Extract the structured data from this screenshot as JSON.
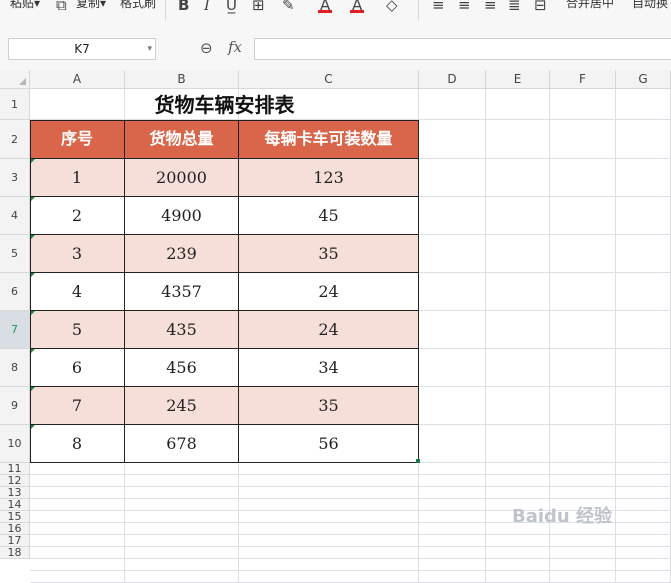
{
  "toolbar": {
    "paste": "粘贴",
    "copy": "复制",
    "format_painter": "格式刷",
    "bold": "B",
    "italic": "I",
    "merge_center": "合并居中",
    "auto_wrap": "自动换"
  },
  "formula_bar": {
    "name_box": "K7",
    "fx": "fx",
    "formula": ""
  },
  "columns": [
    "A",
    "B",
    "C",
    "D",
    "E",
    "F",
    "G"
  ],
  "rows": [
    "1",
    "2",
    "3",
    "4",
    "5",
    "6",
    "7",
    "8",
    "9",
    "10",
    "11",
    "12",
    "13",
    "14",
    "15",
    "16",
    "17",
    "18"
  ],
  "selected_row": "7",
  "sheet": {
    "title": "货物车辆安排表",
    "headers": [
      "序号",
      "货物总量",
      "每辆卡车可装数量"
    ],
    "data": [
      [
        "1",
        "20000",
        "123"
      ],
      [
        "2",
        "4900",
        "45"
      ],
      [
        "3",
        "239",
        "35"
      ],
      [
        "4",
        "4357",
        "24"
      ],
      [
        "5",
        "435",
        "24"
      ],
      [
        "6",
        "456",
        "34"
      ],
      [
        "7",
        "245",
        "35"
      ],
      [
        "8",
        "678",
        "56"
      ]
    ]
  },
  "colors": {
    "header_fill": "#d9664a",
    "band_fill": "#f6dfd9",
    "header_text": "#ffffff"
  },
  "watermark": "Baidu 经验"
}
